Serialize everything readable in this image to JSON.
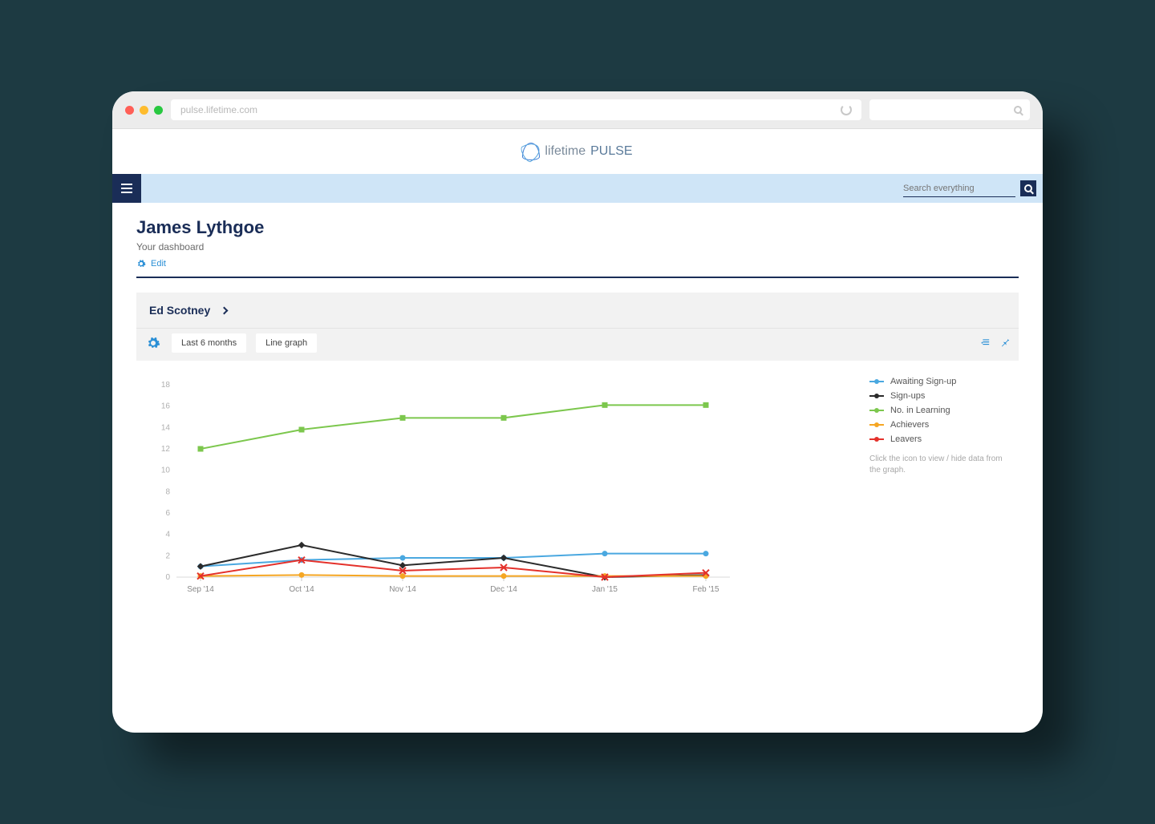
{
  "browser": {
    "url": "pulse.lifetime.com",
    "traffic_colors": [
      "#ff5f57",
      "#febc2e",
      "#28c840"
    ]
  },
  "brand": {
    "name_light": "lifetime",
    "name_bold": "PULSE"
  },
  "topbar": {
    "search_placeholder": "Search everything"
  },
  "header": {
    "user_name": "James Lythgoe",
    "subtitle": "Your dashboard",
    "edit_label": "Edit"
  },
  "panel": {
    "title": "Ed Scotney",
    "range_label": "Last 6 months",
    "graph_type_label": "Line graph"
  },
  "legend_hint": "Click the icon to view / hide data from the graph.",
  "chart_data": {
    "type": "line",
    "categories": [
      "Sep '14",
      "Oct '14",
      "Nov '14",
      "Dec '14",
      "Jan '15",
      "Feb '15"
    ],
    "series": [
      {
        "name": "Awaiting Sign-up",
        "color": "#4aa8e0",
        "marker": "circle",
        "values": [
          1.0,
          1.6,
          1.8,
          1.8,
          2.2,
          2.2
        ]
      },
      {
        "name": "Sign-ups",
        "color": "#2b2b2b",
        "marker": "diamond",
        "values": [
          1.0,
          3.0,
          1.1,
          1.8,
          0.0,
          0.2
        ]
      },
      {
        "name": "No. in Learning",
        "color": "#7cc74d",
        "marker": "square",
        "values": [
          12.0,
          13.8,
          14.9,
          14.9,
          16.1,
          16.1
        ]
      },
      {
        "name": "Achievers",
        "color": "#f5a623",
        "marker": "circle",
        "values": [
          0.1,
          0.2,
          0.1,
          0.1,
          0.1,
          0.1
        ]
      },
      {
        "name": "Leavers",
        "color": "#e4312b",
        "marker": "cross",
        "values": [
          0.1,
          1.6,
          0.6,
          0.9,
          0.0,
          0.4
        ]
      }
    ],
    "ylim": [
      0,
      18
    ],
    "ytick": 2,
    "xlabel": "",
    "ylabel": "",
    "title": ""
  }
}
